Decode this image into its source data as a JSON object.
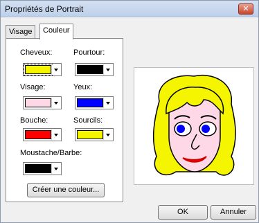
{
  "window": {
    "title": "Propriétés de Portrait",
    "close_glyph": "✕"
  },
  "tabs": [
    {
      "label": "Visage",
      "active": false
    },
    {
      "label": "Couleur",
      "active": true
    }
  ],
  "color_fields": {
    "hair": {
      "label": "Cheveux:",
      "color": "#f5f500"
    },
    "outline": {
      "label": "Pourtour:",
      "color": "#000000"
    },
    "face": {
      "label": "Visage:",
      "color": "#ffd8e8"
    },
    "eyes": {
      "label": "Yeux:",
      "color": "#0000ff"
    },
    "mouth": {
      "label": "Bouche:",
      "color": "#ff0000"
    },
    "eyebrows": {
      "label": "Sourcils:",
      "color": "#f5f500"
    },
    "beard": {
      "label": "Moustache/Barbe:",
      "color": "#000000"
    }
  },
  "buttons": {
    "create_color": "Créer une couleur...",
    "ok": "OK",
    "cancel": "Annuler"
  },
  "preview": {
    "hair_color": "#f5f500",
    "face_color": "#ffd8e8",
    "eye_color": "#0000ff",
    "mouth_color": "#ff0000",
    "outline_color": "#000000"
  }
}
